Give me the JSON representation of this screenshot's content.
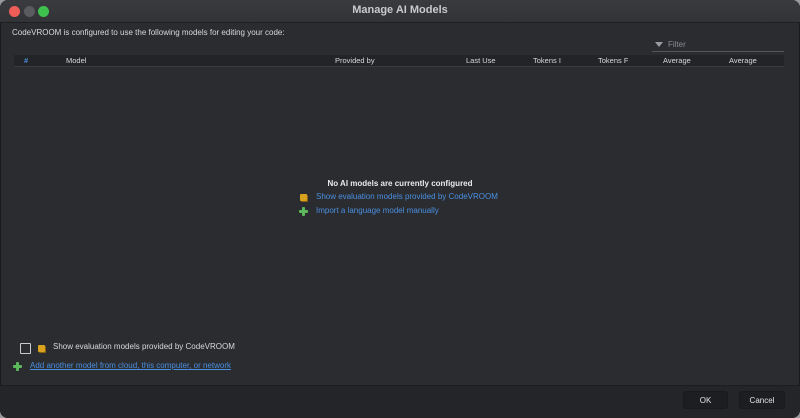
{
  "window": {
    "title": "Manage AI Models"
  },
  "intro_text": "CodeVROOM is configured to use the following models for editing your code:",
  "filter": {
    "placeholder": "Filter"
  },
  "table": {
    "columns": [
      "#",
      "Model",
      "Provided by",
      "Last Use",
      "Tokens I",
      "Tokens F",
      "Average",
      "Average"
    ]
  },
  "empty_state": {
    "title": "No AI models are currently configured",
    "show_evaluation_link": "Show evaluation models provided by CodeVROOM",
    "import_link": "Import a language model manually"
  },
  "footer": {
    "show_evaluation_label": "Show evaluation models provided by CodeVROOM",
    "show_evaluation_checked": false,
    "add_model_link": "Add another model from cloud, this computer, or network"
  },
  "buttons": {
    "ok": "OK",
    "cancel": "Cancel"
  },
  "icons": {
    "cube": "package-cube-icon",
    "plus": "add-plus-icon",
    "filter": "filter-funnel-icon"
  },
  "colors": {
    "link": "#4a8fe0",
    "plus": "#5cb85c",
    "cube": "#d9a21e"
  }
}
